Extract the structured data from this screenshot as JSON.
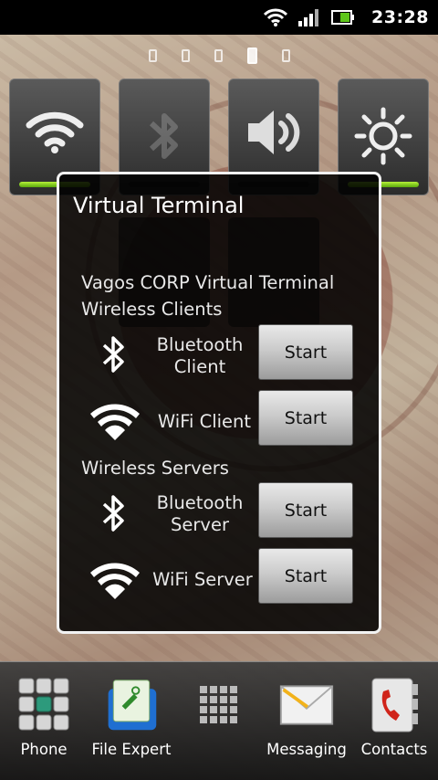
{
  "status_bar": {
    "time": "23:28",
    "icons": [
      "wifi-icon",
      "signal-icon",
      "battery-icon"
    ]
  },
  "home": {
    "page_count": 5,
    "active_page": 4,
    "widget": [
      {
        "name": "wifi-toggle",
        "icon": "wifi-icon",
        "on": true
      },
      {
        "name": "bluetooth-toggle",
        "icon": "bluetooth-icon",
        "on": false
      },
      {
        "name": "sound-toggle",
        "icon": "speaker-icon",
        "on": false
      },
      {
        "name": "brightness-toggle",
        "icon": "sun-icon",
        "on": true
      }
    ]
  },
  "dialog": {
    "title": "Virtual Terminal",
    "heading_line1": "Vagos CORP Virtual Terminal",
    "clients_heading": "Wireless Clients",
    "servers_heading": "Wireless Servers",
    "bt_client_line1": "Bluetooth",
    "bt_client_line2": "Client",
    "wifi_client": "WiFi Client",
    "bt_server_line1": "Bluetooth",
    "bt_server_line2": "Server",
    "wifi_server": "WiFi Server",
    "start_label": "Start"
  },
  "dock": {
    "phone": "Phone",
    "file_expert": "File Expert",
    "messaging": "Messaging",
    "contacts": "Contacts"
  },
  "colors": {
    "toggle_on": "#8ed41c",
    "dialog_border": "#f2f2f2"
  }
}
